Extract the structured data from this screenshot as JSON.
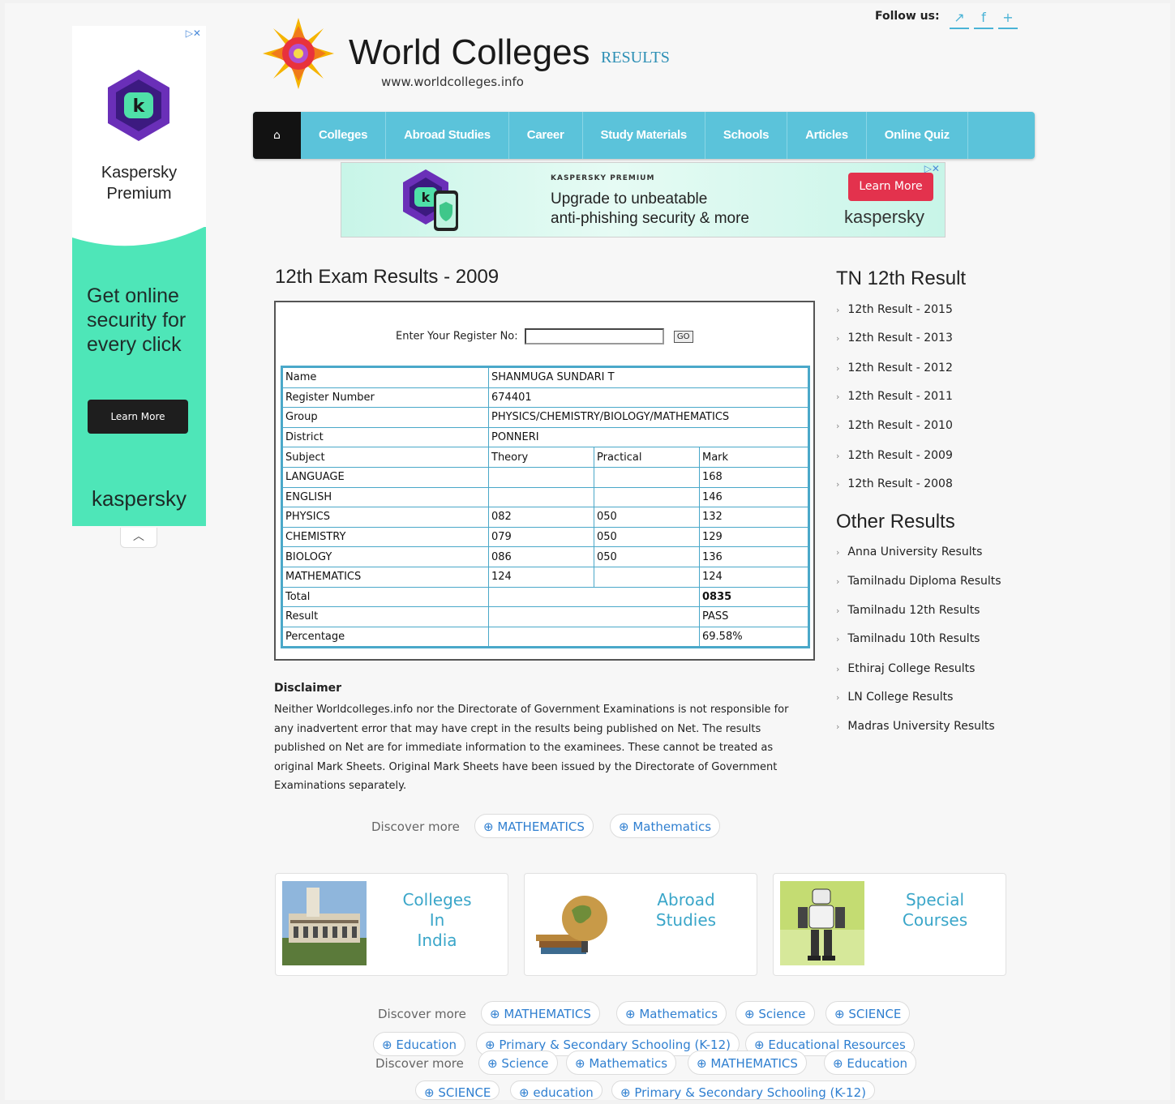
{
  "header": {
    "site_title": "World Colleges",
    "site_tag": "RESULTS",
    "site_url": "www.worldcolleges.info",
    "follow_label": "Follow us:",
    "social": [
      {
        "icon": "share-icon",
        "glyph": "↗"
      },
      {
        "icon": "facebook-icon",
        "glyph": "f"
      },
      {
        "icon": "plus-icon",
        "glyph": "+"
      }
    ]
  },
  "nav": {
    "home_glyph": "⌂",
    "items": [
      "Colleges",
      "Abroad Studies",
      "Career",
      "Study Materials",
      "Schools",
      "Articles",
      "Online Quiz"
    ]
  },
  "side_ad": {
    "brand_line": "Kaspersky Premium",
    "slogan": "Get online security for every click",
    "button": "Learn More",
    "brand": "kaspersky",
    "adchoice": "▷✕"
  },
  "banner_ad": {
    "tag": "KASPERSKY PREMIUM",
    "copy1": "Upgrade to unbeatable",
    "copy2": "anti-phishing security & more",
    "button": "Learn More",
    "brand": "kaspersky",
    "adchoice": "▷✕"
  },
  "main": {
    "title": "12th Exam Results - 2009",
    "register_label": "Enter Your Register No:",
    "register_value": "",
    "go_label": "GO",
    "student": {
      "name_label": "Name",
      "name": "SHANMUGA SUNDARI T",
      "regno_label": "Register Number",
      "regno": "674401",
      "group_label": "Group",
      "group": "PHYSICS/CHEMISTRY/BIOLOGY/MATHEMATICS",
      "district_label": "District",
      "district": "PONNERI"
    },
    "columns": [
      "Subject",
      "Theory",
      "Practical",
      "Mark"
    ],
    "subjects": [
      {
        "subject": "LANGUAGE",
        "theory": "",
        "practical": "",
        "mark": "168"
      },
      {
        "subject": "ENGLISH",
        "theory": "",
        "practical": "",
        "mark": "146"
      },
      {
        "subject": "PHYSICS",
        "theory": "082",
        "practical": "050",
        "mark": "132"
      },
      {
        "subject": "CHEMISTRY",
        "theory": "079",
        "practical": "050",
        "mark": "129"
      },
      {
        "subject": "BIOLOGY",
        "theory": "086",
        "practical": "050",
        "mark": "136"
      },
      {
        "subject": "MATHEMATICS",
        "theory": "124",
        "practical": "",
        "mark": "124"
      }
    ],
    "summary": {
      "total_label": "Total",
      "total": "0835",
      "result_label": "Result",
      "result": "PASS",
      "percent_label": "Percentage",
      "percent": "69.58%"
    },
    "disclaimer_title": "Disclaimer",
    "disclaimer_text": "Neither Worldcolleges.info nor the Directorate of Government Examinations is not responsible for any inadvertent error that may have crept in the results being published on Net. The results published on Net are for immediate information to the examinees. These cannot be treated as original Mark Sheets. Original Mark Sheets have been issued by the Directorate of Government Examinations separately."
  },
  "discover": {
    "label": "Discover more",
    "row1": [
      "MATHEMATICS",
      "Mathematics"
    ],
    "row2": [
      "MATHEMATICS",
      "Mathematics",
      "Science",
      "SCIENCE"
    ],
    "row3": [
      "Education",
      "Primary & Secondary Schooling (K-12)",
      "Educational Resources"
    ],
    "row4": [
      "Science",
      "Mathematics",
      "MATHEMATICS",
      "Education"
    ],
    "row5": [
      "SCIENCE",
      "education",
      "Primary & Secondary Schooling (K-12)"
    ]
  },
  "cards": [
    {
      "label_lines": [
        "Colleges",
        "In",
        "India"
      ],
      "image": "college-building-photo"
    },
    {
      "label_lines": [
        "Abroad",
        "Studies"
      ],
      "image": "globe-books-photo"
    },
    {
      "label_lines": [
        "Special",
        "Courses"
      ],
      "image": "robot-photo"
    }
  ],
  "sidebar": {
    "tn_heading": "TN 12th Result",
    "tn_links": [
      "12th Result - 2015",
      "12th Result - 2013",
      "12th Result - 2012",
      "12th Result - 2011",
      "12th Result - 2010",
      "12th Result - 2009",
      "12th Result - 2008"
    ],
    "other_heading": "Other Results",
    "other_links": [
      "Anna University Results",
      "Tamilnadu Diploma Results",
      "Tamilnadu 12th Results",
      "Tamilnadu 10th Results",
      "Ethiraj College Results",
      "LN College Results",
      "Madras University Results"
    ]
  },
  "colors": {
    "nav": "#5bc3da",
    "link": "#2f7fd0",
    "card_label": "#3aa6c9",
    "ad_green": "#4ee6b8",
    "ad_button": "#e3324d"
  }
}
